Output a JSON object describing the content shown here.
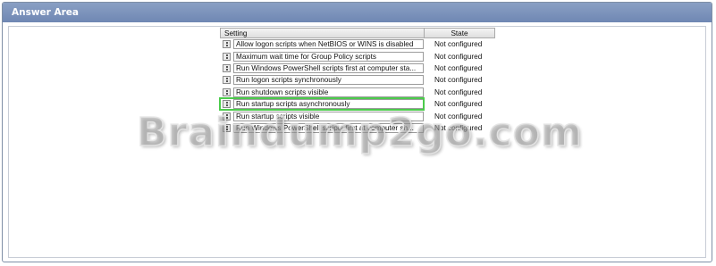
{
  "window": {
    "title": "Answer Area"
  },
  "grid": {
    "columns": {
      "setting": "Setting",
      "state": "State"
    },
    "rows": [
      {
        "setting": "Allow logon scripts when NetBIOS or WINS is disabled",
        "state": "Not configured"
      },
      {
        "setting": "Maximum wait time for Group Policy scripts",
        "state": "Not configured"
      },
      {
        "setting": "Run Windows PowerShell scripts first at computer sta...",
        "state": "Not configured"
      },
      {
        "setting": "Run logon scripts synchronously",
        "state": "Not configured"
      },
      {
        "setting": "Run shutdown scripts visible",
        "state": "Not configured"
      },
      {
        "setting": "Run startup scripts asynchronously",
        "state": "Not configured"
      },
      {
        "setting": "Run startup scripts visible",
        "state": "Not configured"
      },
      {
        "setting": "Run Windows PowerShell scripts first at computer sh...",
        "state": "Not configured"
      }
    ],
    "selected_row": 5,
    "highlight_color": "#4ccb4c"
  },
  "watermark": {
    "text": "Braindump2go.com"
  }
}
